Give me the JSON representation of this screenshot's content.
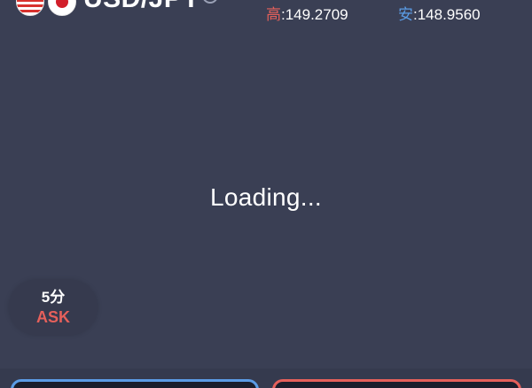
{
  "header": {
    "pair": "USD/JPY",
    "flags": [
      "us-flag-icon",
      "jp-flag-icon"
    ],
    "high_label": "高",
    "high_value": ":149.2709",
    "low_label": "安",
    "low_value": ":148.9560"
  },
  "chart": {
    "loading_text": "Loading..."
  },
  "timeframe": {
    "interval": "5分",
    "price_type": "ASK"
  },
  "colors": {
    "background": "#3a3f54",
    "high": "#e5605b",
    "low": "#5b9ce6",
    "text": "#ffffff"
  }
}
